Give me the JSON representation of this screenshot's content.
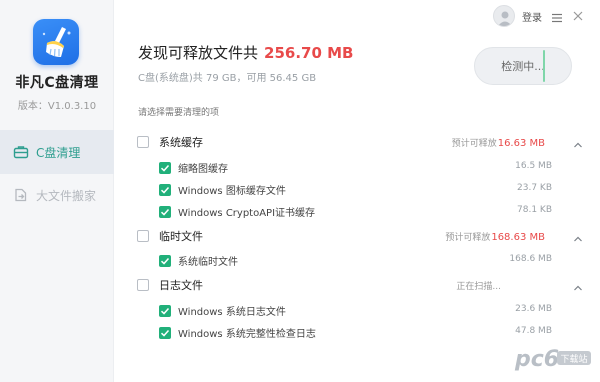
{
  "app": {
    "name": "非凡C盘清理",
    "version": "版本：V1.0.3.10"
  },
  "sidebar": {
    "items": [
      {
        "label": "C盘清理",
        "icon": "toolbox-icon",
        "active": true
      },
      {
        "label": "大文件搬家",
        "icon": "file-move-icon",
        "active": false
      }
    ]
  },
  "topbar": {
    "login_label": "登录"
  },
  "summary": {
    "title_prefix": "发现可释放文件共",
    "title_size": "256.70 MB",
    "disk_info": "C盘(系统盘)共 79 GB，可用 56.45 GB"
  },
  "detect_button": {
    "label": "检测中..."
  },
  "select_tip": "请选择需要清理的项",
  "groups": [
    {
      "label": "系统缓存",
      "estimate_prefix": "预计可释放",
      "estimate_value": "16.63 MB",
      "status": "",
      "items": [
        {
          "label": "缩略图缓存",
          "size": "16.5 MB"
        },
        {
          "label": "Windows 图标缓存文件",
          "size": "23.7 KB"
        },
        {
          "label": "Windows CryptoAPI证书缓存",
          "size": "78.1 KB"
        }
      ]
    },
    {
      "label": "临时文件",
      "estimate_prefix": "预计可释放",
      "estimate_value": "168.63 MB",
      "status": "",
      "items": [
        {
          "label": "系统临时文件",
          "size": "168.6 MB"
        }
      ]
    },
    {
      "label": "日志文件",
      "estimate_prefix": "",
      "estimate_value": "",
      "status": "正在扫描...",
      "items": [
        {
          "label": "Windows 系统日志文件",
          "size": "23.6 MB"
        },
        {
          "label": "Windows 系统完整性检查日志",
          "size": "47.8 MB"
        }
      ]
    }
  ],
  "watermark": {
    "text": "pc6",
    "sub": "下载站"
  },
  "colors": {
    "accent": "#21b07a",
    "highlight": "#e84a4a",
    "brand_blue": "#2b80f0"
  }
}
